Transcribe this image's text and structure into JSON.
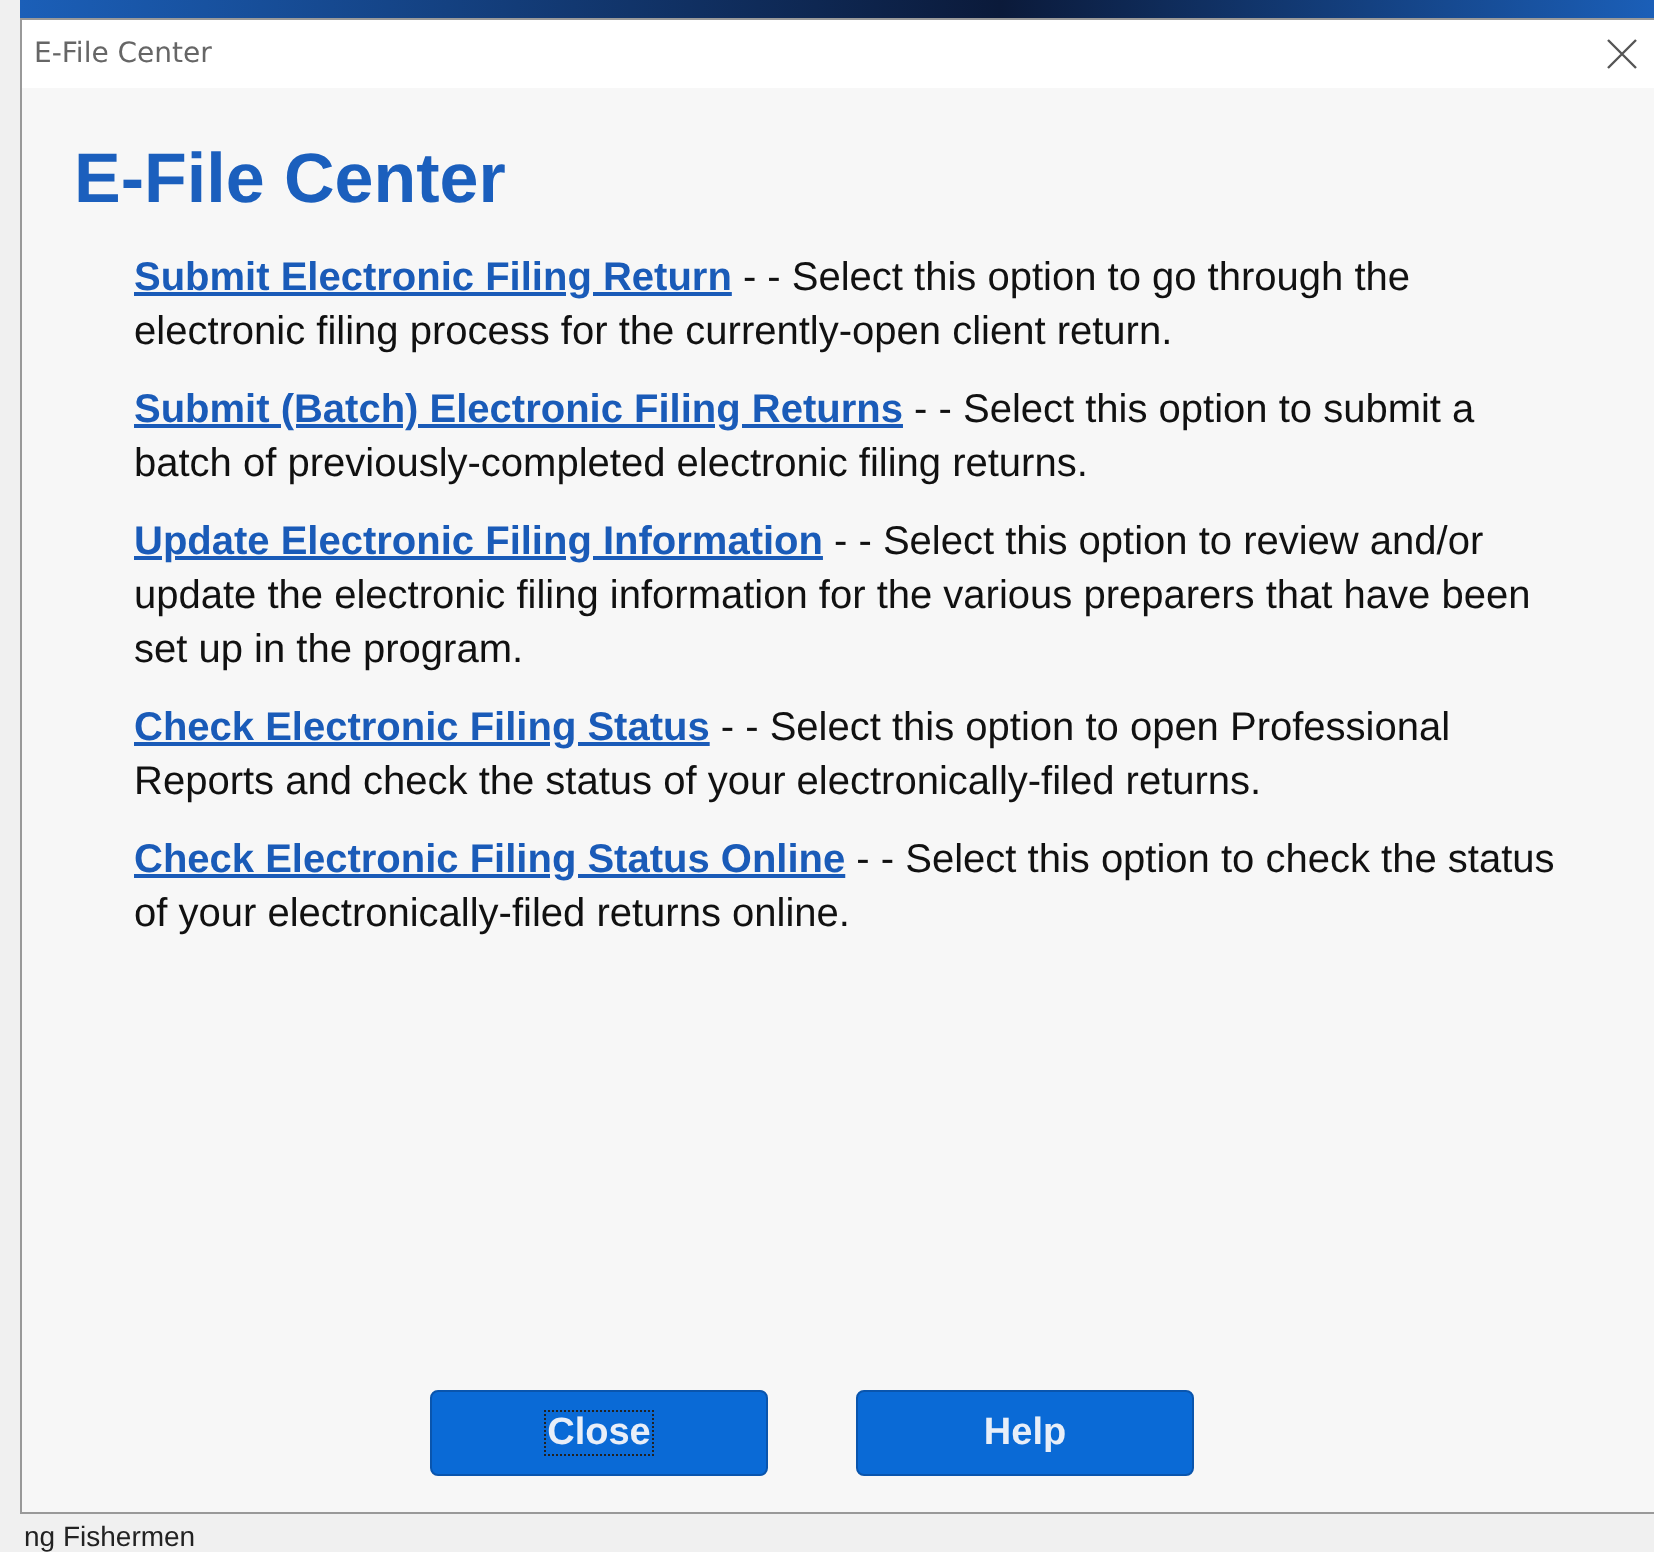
{
  "window": {
    "title": "E-File Center"
  },
  "heading": "E-File Center",
  "options": [
    {
      "link": "Submit Electronic Filing Return",
      "description": " - - Select this option to go through the electronic filing process for the currently-open client return."
    },
    {
      "link": "Submit (Batch) Electronic Filing Returns",
      "description": " - - Select this option to submit a batch of previously-completed electronic filing returns."
    },
    {
      "link": "Update Electronic Filing Information",
      "description": " - - Select this option to review and/or update the electronic filing information for the various preparers that have been set up in the program."
    },
    {
      "link": "Check Electronic Filing Status",
      "description": " - - Select this option to open Professional Reports and check the status of your electronically-filed returns."
    },
    {
      "link": "Check Electronic Filing Status Online",
      "description": " - - Select this option to check the status of your electronically-filed returns online."
    }
  ],
  "buttons": [
    {
      "label": "Close",
      "focused": true
    },
    {
      "label": "Help",
      "focused": false
    }
  ],
  "background_text": "ng Fishermen"
}
